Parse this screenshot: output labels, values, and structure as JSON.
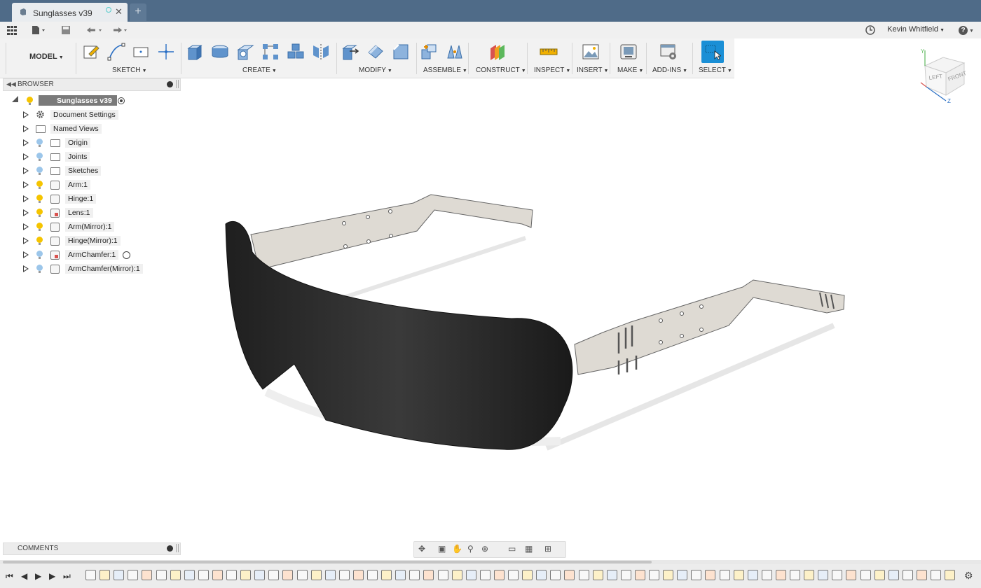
{
  "app": {
    "tab_title": "Sunglasses v39",
    "new_tab_symbol": "+",
    "close_symbol": "✕"
  },
  "quickbar": {
    "user_name": "Kevin Whitfield",
    "help_symbol": "?"
  },
  "ribbon": {
    "workspace": "MODEL",
    "groups": [
      {
        "label": "SKETCH"
      },
      {
        "label": "CREATE"
      },
      {
        "label": "MODIFY"
      },
      {
        "label": "ASSEMBLE"
      },
      {
        "label": "CONSTRUCT"
      },
      {
        "label": "INSPECT"
      },
      {
        "label": "INSERT"
      },
      {
        "label": "MAKE"
      },
      {
        "label": "ADD-INS"
      },
      {
        "label": "SELECT"
      }
    ]
  },
  "browser": {
    "title": "BROWSER",
    "root": "Sunglasses v39",
    "items": [
      {
        "label": "Document Settings",
        "icon": "gear-icon"
      },
      {
        "label": "Named Views",
        "icon": "folder-icon"
      },
      {
        "label": "Origin",
        "icon": "folder-icon"
      },
      {
        "label": "Joints",
        "icon": "folder-icon"
      },
      {
        "label": "Sketches",
        "icon": "folder-icon"
      },
      {
        "label": "Arm:1",
        "icon": "component-icon"
      },
      {
        "label": "Hinge:1",
        "icon": "component-icon"
      },
      {
        "label": "Lens:1",
        "icon": "component-icon"
      },
      {
        "label": "Arm(Mirror):1",
        "icon": "component-icon"
      },
      {
        "label": "Hinge(Mirror):1",
        "icon": "component-icon"
      },
      {
        "label": "ArmChamfer:1",
        "icon": "component-icon"
      },
      {
        "label": "ArmChamfer(Mirror):1",
        "icon": "component-icon"
      }
    ]
  },
  "comments": {
    "title": "COMMENTS"
  },
  "viewcube": {
    "left": "LEFT",
    "front": "FRONT",
    "y_axis": "Y",
    "z_axis": "Z"
  },
  "colors": {
    "titlebar": "#4f6b88",
    "select_accent": "#1a8fd6",
    "bulb_on": "#f5c400",
    "bulb_off": "#9cc6ea"
  }
}
